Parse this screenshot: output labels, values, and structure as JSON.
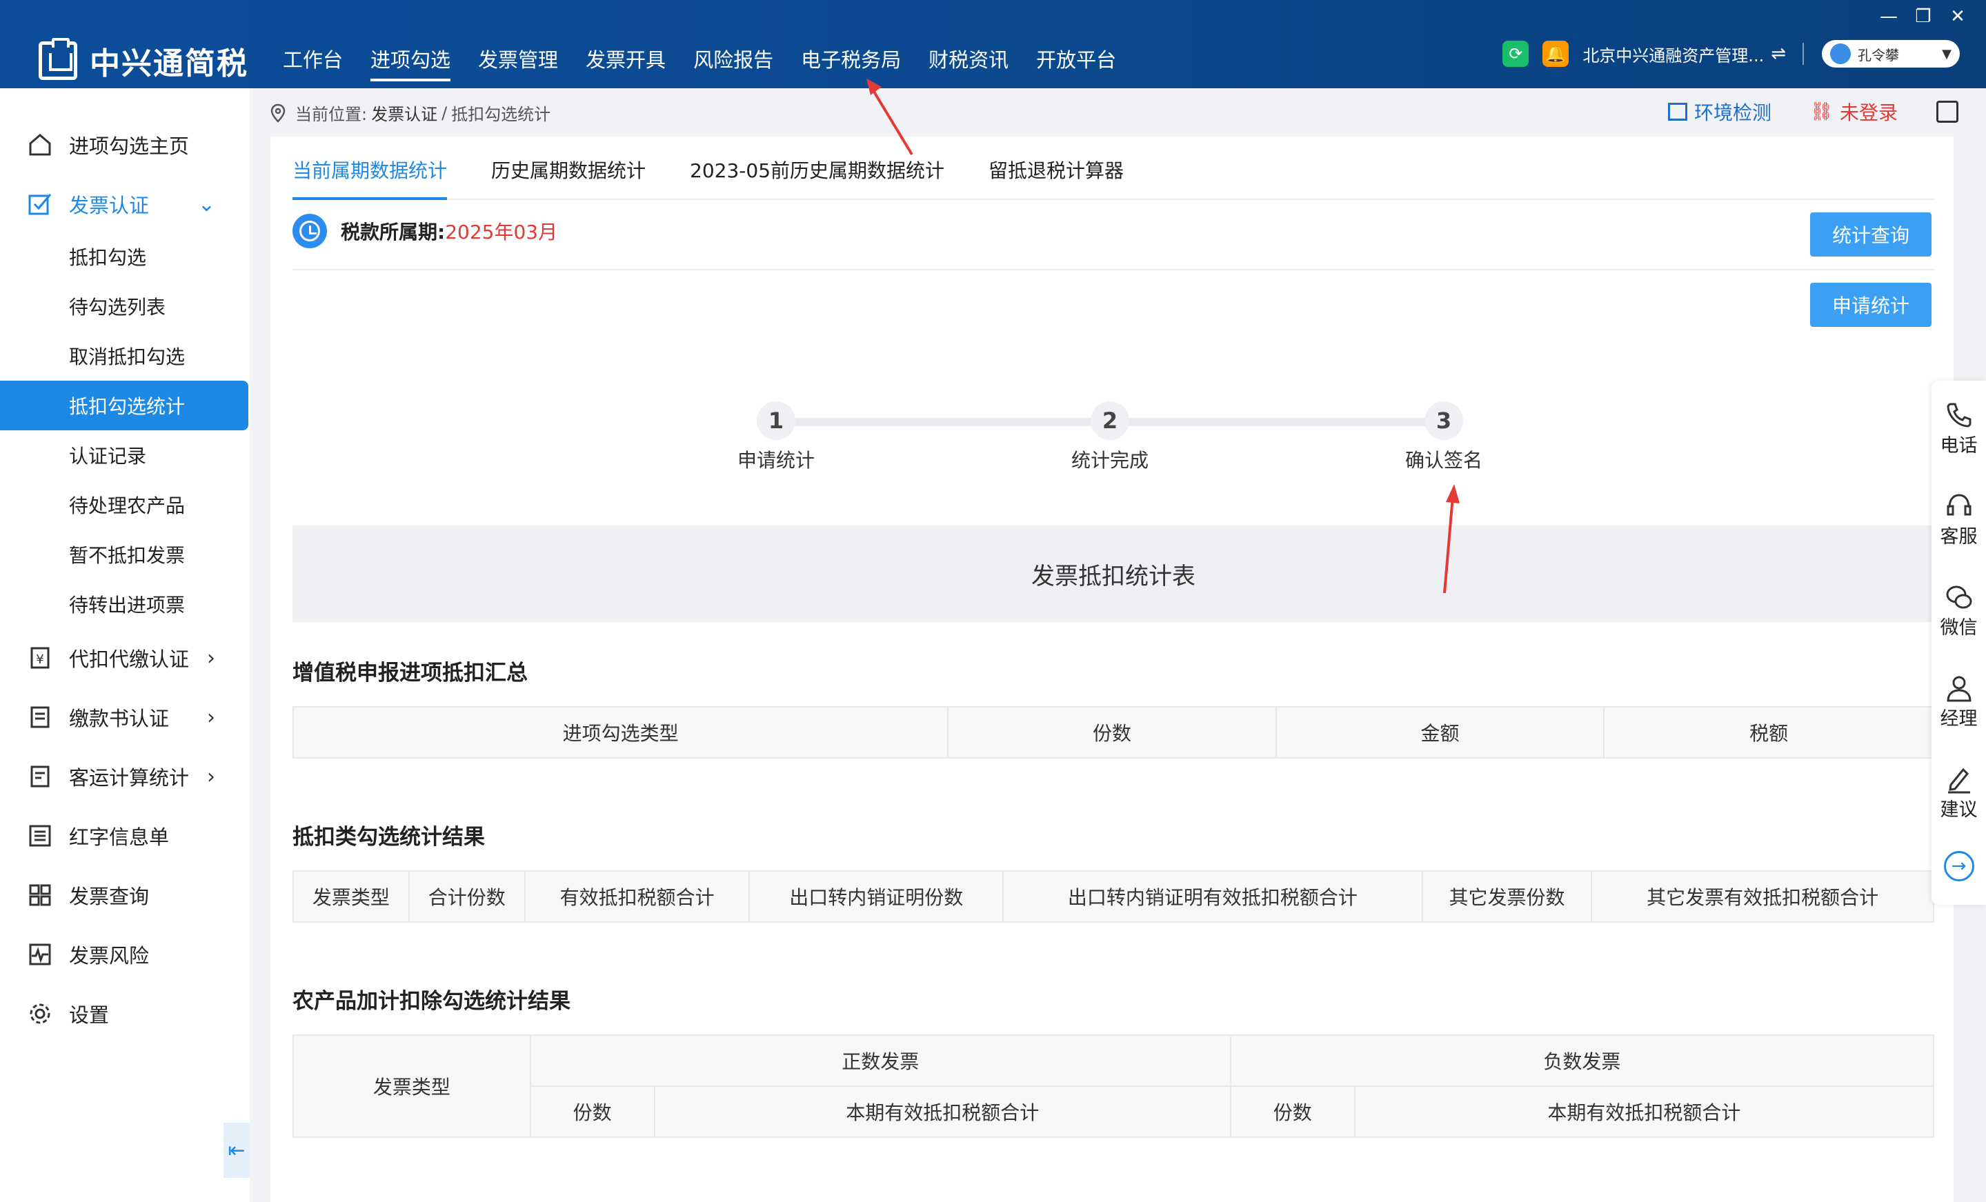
{
  "app": {
    "title": "中兴通简税",
    "nav": [
      "工作台",
      "进项勾选",
      "发票管理",
      "发票开具",
      "风险报告",
      "电子税务局",
      "财税资讯",
      "开放平台"
    ],
    "active_nav_index": 1,
    "company": "北京中兴通融资产管理...",
    "user": "孔令攀",
    "window_controls": [
      "—",
      "❐",
      "✕"
    ]
  },
  "sidebar": {
    "items": [
      {
        "label": "进项勾选主页",
        "icon": "home-icon"
      },
      {
        "label": "发票认证",
        "icon": "checkbox-icon",
        "open": true
      },
      {
        "label": "代扣代缴认证",
        "icon": "yuan-doc-icon"
      },
      {
        "label": "缴款书认证",
        "icon": "doc-icon"
      },
      {
        "label": "客运计算统计",
        "icon": "doc-icon"
      },
      {
        "label": "红字信息单",
        "icon": "list-icon"
      },
      {
        "label": "发票查询",
        "icon": "grid-icon"
      },
      {
        "label": "发票风险",
        "icon": "pulse-icon"
      },
      {
        "label": "设置",
        "icon": "gear-icon"
      }
    ],
    "sub_items": [
      "抵扣勾选",
      "待勾选列表",
      "取消抵扣勾选",
      "抵扣勾选统计",
      "认证记录",
      "待处理农产品",
      "暂不抵扣发票",
      "待转出进项票"
    ],
    "active_sub_index": 3
  },
  "breadcrumb": {
    "prefix": "当前位置:",
    "path": [
      "发票认证",
      "/",
      "抵扣勾选统计"
    ]
  },
  "header_right": {
    "env": "环境检测",
    "login": "未登录"
  },
  "tabs": [
    "当前属期数据统计",
    "历史属期数据统计",
    "2023-05前历史属期数据统计",
    "留抵退税计算器"
  ],
  "period": {
    "label": "税款所属期:",
    "value": "2025年03月"
  },
  "buttons": {
    "query": "统计查询",
    "apply": "申请统计"
  },
  "steps": [
    {
      "num": "1",
      "label": "申请统计"
    },
    {
      "num": "2",
      "label": "统计完成"
    },
    {
      "num": "3",
      "label": "确认签名"
    }
  ],
  "banner": "发票抵扣统计表",
  "section1": {
    "title": "增值税申报进项抵扣汇总",
    "headers": [
      "进项勾选类型",
      "份数",
      "金额",
      "税额"
    ]
  },
  "section2": {
    "title": "抵扣类勾选统计结果",
    "headers": [
      "发票类型",
      "合计份数",
      "有效抵扣税额合计",
      "出口转内销证明份数",
      "出口转内销证明有效抵扣税额合计",
      "其它发票份数",
      "其它发票有效抵扣税额合计"
    ]
  },
  "section3": {
    "title": "农产品加计扣除勾选统计结果",
    "type_header": "发票类型",
    "positive": "正数发票",
    "negative": "负数发票",
    "count": "份数",
    "amount": "本期有效抵扣税额合计"
  },
  "float_bar": [
    "电话",
    "客服",
    "微信",
    "经理",
    "建议"
  ],
  "colors": {
    "primary": "#1e88e5",
    "topbar": "#0c4d9a",
    "danger": "#e53935"
  }
}
